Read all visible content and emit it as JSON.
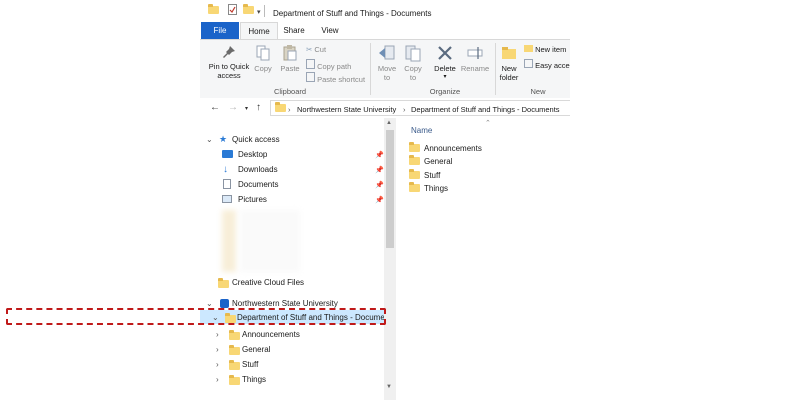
{
  "window": {
    "title": "Department of Stuff and Things - Documents"
  },
  "tabs": {
    "file": "File",
    "home": "Home",
    "share": "Share",
    "view": "View"
  },
  "ribbon": {
    "clipboard": {
      "pin_line1": "Pin to Quick",
      "pin_line2": "access",
      "copy": "Copy",
      "paste": "Paste",
      "cut": "Cut",
      "copy_path": "Copy path",
      "paste_shortcut": "Paste shortcut",
      "label": "Clipboard"
    },
    "organize": {
      "move_line1": "Move",
      "move_line2": "to",
      "copy_line1": "Copy",
      "copy_line2": "to",
      "delete": "Delete",
      "rename": "Rename",
      "label": "Organize"
    },
    "new": {
      "folder_line1": "New",
      "folder_line2": "folder",
      "new_item": "New item",
      "easy_access": "Easy acces",
      "label": "New"
    }
  },
  "address": {
    "crumbs": [
      "Northwestern State University",
      "Department of Stuff and Things - Documents"
    ]
  },
  "nav": {
    "quick_access": "Quick access",
    "quick_items": [
      "Desktop",
      "Downloads",
      "Documents",
      "Pictures"
    ],
    "creative_cloud": "Creative Cloud Files",
    "org": "Northwestern State University",
    "library": "Department of Stuff and Things - Documents",
    "subfolders": [
      "Announcements",
      "General",
      "Stuff",
      "Things"
    ]
  },
  "content": {
    "column_name": "Name",
    "items": [
      "Announcements",
      "General",
      "Stuff",
      "Things"
    ]
  },
  "colors": {
    "file_tab": "#1a63c9",
    "folder": "#f8d775",
    "highlight": "#c01a1a",
    "selection": "#cce8ff"
  }
}
